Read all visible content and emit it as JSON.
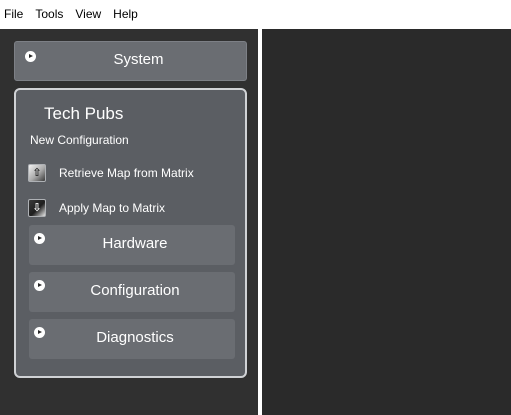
{
  "menu": {
    "items": [
      {
        "label": "File"
      },
      {
        "label": "Tools"
      },
      {
        "label": "View"
      },
      {
        "label": "Help"
      }
    ]
  },
  "sidebar": {
    "system": {
      "label": "System",
      "icon": "play-circle-icon"
    },
    "techpubs": {
      "title": "Tech Pubs",
      "subtitle": "New Configuration",
      "actions": [
        {
          "label": "Retrieve Map from Matrix",
          "icon": "retrieve-map-icon"
        },
        {
          "label": "Apply Map to Matrix",
          "icon": "apply-map-icon"
        }
      ],
      "sections": [
        {
          "label": "Hardware",
          "icon": "play-circle-icon"
        },
        {
          "label": "Configuration",
          "icon": "play-circle-icon"
        },
        {
          "label": "Diagnostics",
          "icon": "play-circle-icon"
        }
      ]
    }
  },
  "colors": {
    "background": "#2b2b2b",
    "panel": "#5b5e63",
    "button": "#6a6d72",
    "panel_border": "#d0d2d5"
  }
}
